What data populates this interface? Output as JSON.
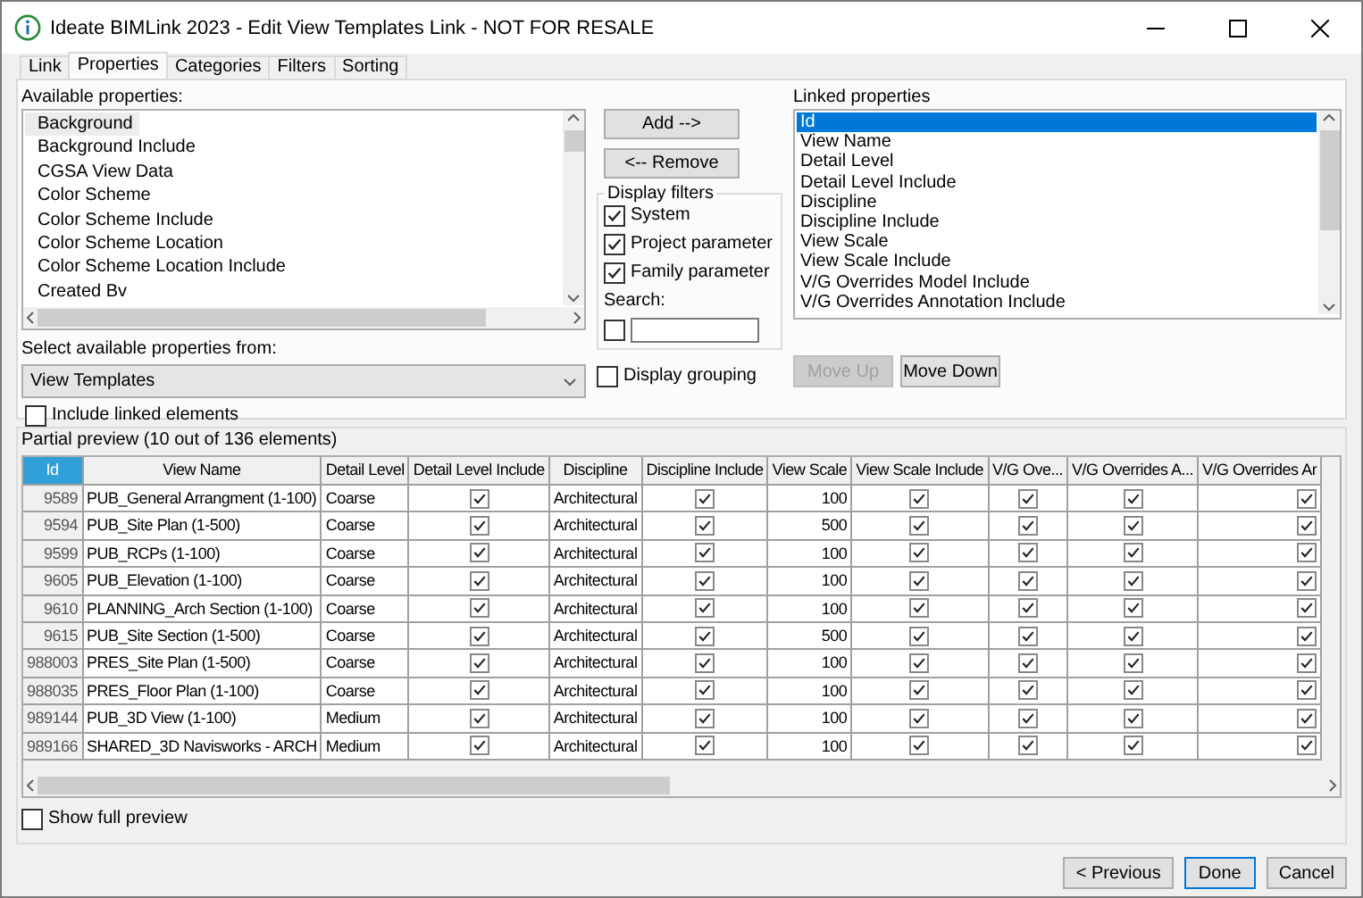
{
  "window": {
    "title": "Ideate BIMLink 2023 - Edit View Templates Link - NOT FOR RESALE"
  },
  "tabs": [
    {
      "label": "Link",
      "selected": false
    },
    {
      "label": "Properties",
      "selected": true
    },
    {
      "label": "Categories",
      "selected": false
    },
    {
      "label": "Filters",
      "selected": false
    },
    {
      "label": "Sorting",
      "selected": false
    }
  ],
  "available_properties": {
    "label": "Available properties:",
    "items": [
      {
        "label": "Background",
        "selected": true
      },
      {
        "label": "Background Include",
        "selected": false
      },
      {
        "label": "CGSA View Data",
        "selected": false
      },
      {
        "label": "Color Scheme",
        "selected": false
      },
      {
        "label": "Color Scheme Include",
        "selected": false
      },
      {
        "label": "Color Scheme Location",
        "selected": false
      },
      {
        "label": "Color Scheme Location Include",
        "selected": false
      },
      {
        "label": "Created Bv",
        "selected": false
      }
    ]
  },
  "add_button": "Add -->",
  "remove_button": "<-- Remove",
  "display_filters": {
    "legend": "Display filters",
    "options": [
      {
        "label": "System",
        "checked": true
      },
      {
        "label": "Project parameter",
        "checked": true
      },
      {
        "label": "Family parameter",
        "checked": true
      }
    ],
    "search_label": "Search:",
    "search_checked": false
  },
  "linked_properties": {
    "label": "Linked properties",
    "items": [
      {
        "label": "Id",
        "selected": true
      },
      {
        "label": "View Name",
        "selected": false
      },
      {
        "label": "Detail Level",
        "selected": false
      },
      {
        "label": "Detail Level Include",
        "selected": false
      },
      {
        "label": "Discipline",
        "selected": false
      },
      {
        "label": "Discipline Include",
        "selected": false
      },
      {
        "label": "View Scale",
        "selected": false
      },
      {
        "label": "View Scale Include",
        "selected": false
      },
      {
        "label": "V/G Overrides Model Include",
        "selected": false
      },
      {
        "label": "V/G Overrides Annotation Include",
        "selected": false
      }
    ]
  },
  "source": {
    "label": "Select available properties from:",
    "value": "View Templates"
  },
  "display_grouping": {
    "label": "Display grouping",
    "checked": false
  },
  "include_linked": {
    "label": "Include linked elements",
    "checked": false
  },
  "move_buttons": [
    {
      "label": "Move Up",
      "disabled": true
    },
    {
      "label": "Move Down",
      "disabled": false
    }
  ],
  "preview": {
    "title": "Partial preview (10 out of 136 elements)",
    "columns": [
      {
        "label": "Id",
        "kind": "number",
        "selected": true
      },
      {
        "label": "View Name",
        "kind": "text",
        "selected": false
      },
      {
        "label": "Detail Level",
        "kind": "text",
        "selected": false
      },
      {
        "label": "Detail Level Include",
        "kind": "check",
        "selected": false
      },
      {
        "label": "Discipline",
        "kind": "text",
        "selected": false
      },
      {
        "label": "Discipline Include",
        "kind": "check",
        "selected": false
      },
      {
        "label": "View Scale",
        "kind": "number",
        "selected": false
      },
      {
        "label": "View Scale Include",
        "kind": "check",
        "selected": false
      },
      {
        "label": "V/G Ove...",
        "kind": "check",
        "selected": false
      },
      {
        "label": "V/G Overrides A...",
        "kind": "check",
        "selected": false
      },
      {
        "label": "V/G Overrides Ar",
        "kind": "check",
        "selected": false
      }
    ],
    "rows": [
      {
        "cells": [
          "9589",
          "PUB_General Arrangment (1-100)",
          "Coarse",
          true,
          "Architectural",
          true,
          "100",
          true,
          true,
          true,
          true
        ]
      },
      {
        "cells": [
          "9594",
          "PUB_Site Plan (1-500)",
          "Coarse",
          true,
          "Architectural",
          true,
          "500",
          true,
          true,
          true,
          true
        ]
      },
      {
        "cells": [
          "9599",
          "PUB_RCPs (1-100)",
          "Coarse",
          true,
          "Architectural",
          true,
          "100",
          true,
          true,
          true,
          true
        ]
      },
      {
        "cells": [
          "9605",
          "PUB_Elevation (1-100)",
          "Coarse",
          true,
          "Architectural",
          true,
          "100",
          true,
          true,
          true,
          true
        ]
      },
      {
        "cells": [
          "9610",
          "PLANNING_Arch Section (1-100)",
          "Coarse",
          true,
          "Architectural",
          true,
          "100",
          true,
          true,
          true,
          true
        ]
      },
      {
        "cells": [
          "9615",
          "PUB_Site Section (1-500)",
          "Coarse",
          true,
          "Architectural",
          true,
          "500",
          true,
          true,
          true,
          true
        ]
      },
      {
        "cells": [
          "988003",
          "PRES_Site Plan (1-500)",
          "Coarse",
          true,
          "Architectural",
          true,
          "100",
          true,
          true,
          true,
          true
        ]
      },
      {
        "cells": [
          "988035",
          "PRES_Floor Plan (1-100)",
          "Coarse",
          true,
          "Architectural",
          true,
          "100",
          true,
          true,
          true,
          true
        ]
      },
      {
        "cells": [
          "989144",
          "PUB_3D View (1-100)",
          "Medium",
          true,
          "Architectural",
          true,
          "100",
          true,
          true,
          true,
          true
        ]
      },
      {
        "cells": [
          "989166",
          "SHARED_3D Navisworks - ARCH",
          "Medium",
          true,
          "Architectural",
          true,
          "100",
          true,
          true,
          true,
          true
        ]
      }
    ],
    "show_full": {
      "label": "Show full preview",
      "checked": false
    }
  },
  "footer_buttons": [
    {
      "label": "< Previous",
      "default": false
    },
    {
      "label": "Done",
      "default": true
    },
    {
      "label": "Cancel",
      "default": false
    }
  ]
}
